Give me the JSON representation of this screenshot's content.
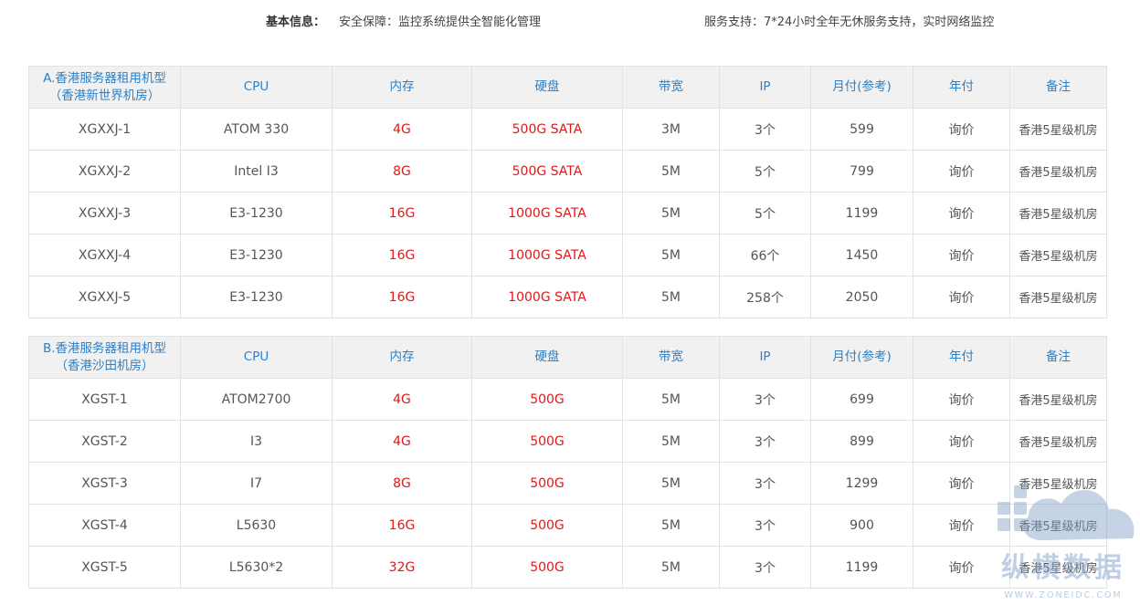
{
  "info": {
    "label": "基本信息：",
    "security": "安全保障：监控系统提供全智能化管理",
    "service": "服务支持：7*24小时全年无休服务支持，实时网络监控"
  },
  "columns": [
    "CPU",
    "内存",
    "硬盘",
    "带宽",
    "IP",
    "月付(参考)",
    "年付",
    "备注"
  ],
  "table_a": {
    "title_line1": "A.香港服务器租用机型",
    "title_line2": "（香港新世界机房）",
    "rows": [
      [
        "XGXXJ-1",
        "ATOM 330",
        "4G",
        "500G SATA",
        "3M",
        "3个",
        "599",
        "询价",
        "香港5星级机房"
      ],
      [
        "XGXXJ-2",
        "Intel I3",
        "8G",
        "500G SATA",
        "5M",
        "5个",
        "799",
        "询价",
        "香港5星级机房"
      ],
      [
        "XGXXJ-3",
        "E3-1230",
        "16G",
        "1000G SATA",
        "5M",
        "5个",
        "1199",
        "询价",
        "香港5星级机房"
      ],
      [
        "XGXXJ-4",
        "E3-1230",
        "16G",
        "1000G SATA",
        "5M",
        "66个",
        "1450",
        "询价",
        "香港5星级机房"
      ],
      [
        "XGXXJ-5",
        "E3-1230",
        "16G",
        "1000G SATA",
        "5M",
        "258个",
        "2050",
        "询价",
        "香港5星级机房"
      ]
    ]
  },
  "table_b": {
    "title_line1": "B.香港服务器租用机型",
    "title_line2": "（香港沙田机房）",
    "rows": [
      [
        "XGST-1",
        "ATOM2700",
        "4G",
        "500G",
        "5M",
        "3个",
        "699",
        "询价",
        "香港5星级机房"
      ],
      [
        "XGST-2",
        "I3",
        "4G",
        "500G",
        "5M",
        "3个",
        "899",
        "询价",
        "香港5星级机房"
      ],
      [
        "XGST-3",
        "I7",
        "8G",
        "500G",
        "5M",
        "3个",
        "1299",
        "询价",
        "香港5星级机房"
      ],
      [
        "XGST-4",
        "L5630",
        "16G",
        "500G",
        "5M",
        "3个",
        "900",
        "询价",
        "香港5星级机房"
      ],
      [
        "XGST-5",
        "L5630*2",
        "32G",
        "500G",
        "5M",
        "3个",
        "1199",
        "询价",
        "香港5星级机房"
      ]
    ]
  },
  "watermark": {
    "brand": "纵横数据",
    "url": "WWW.ZONEIDC.COM"
  },
  "colors": {
    "header_text": "#2f7fc4",
    "header_bg": "#f1f1f1",
    "highlight": "#e01818",
    "border": "#e2e2e2"
  }
}
